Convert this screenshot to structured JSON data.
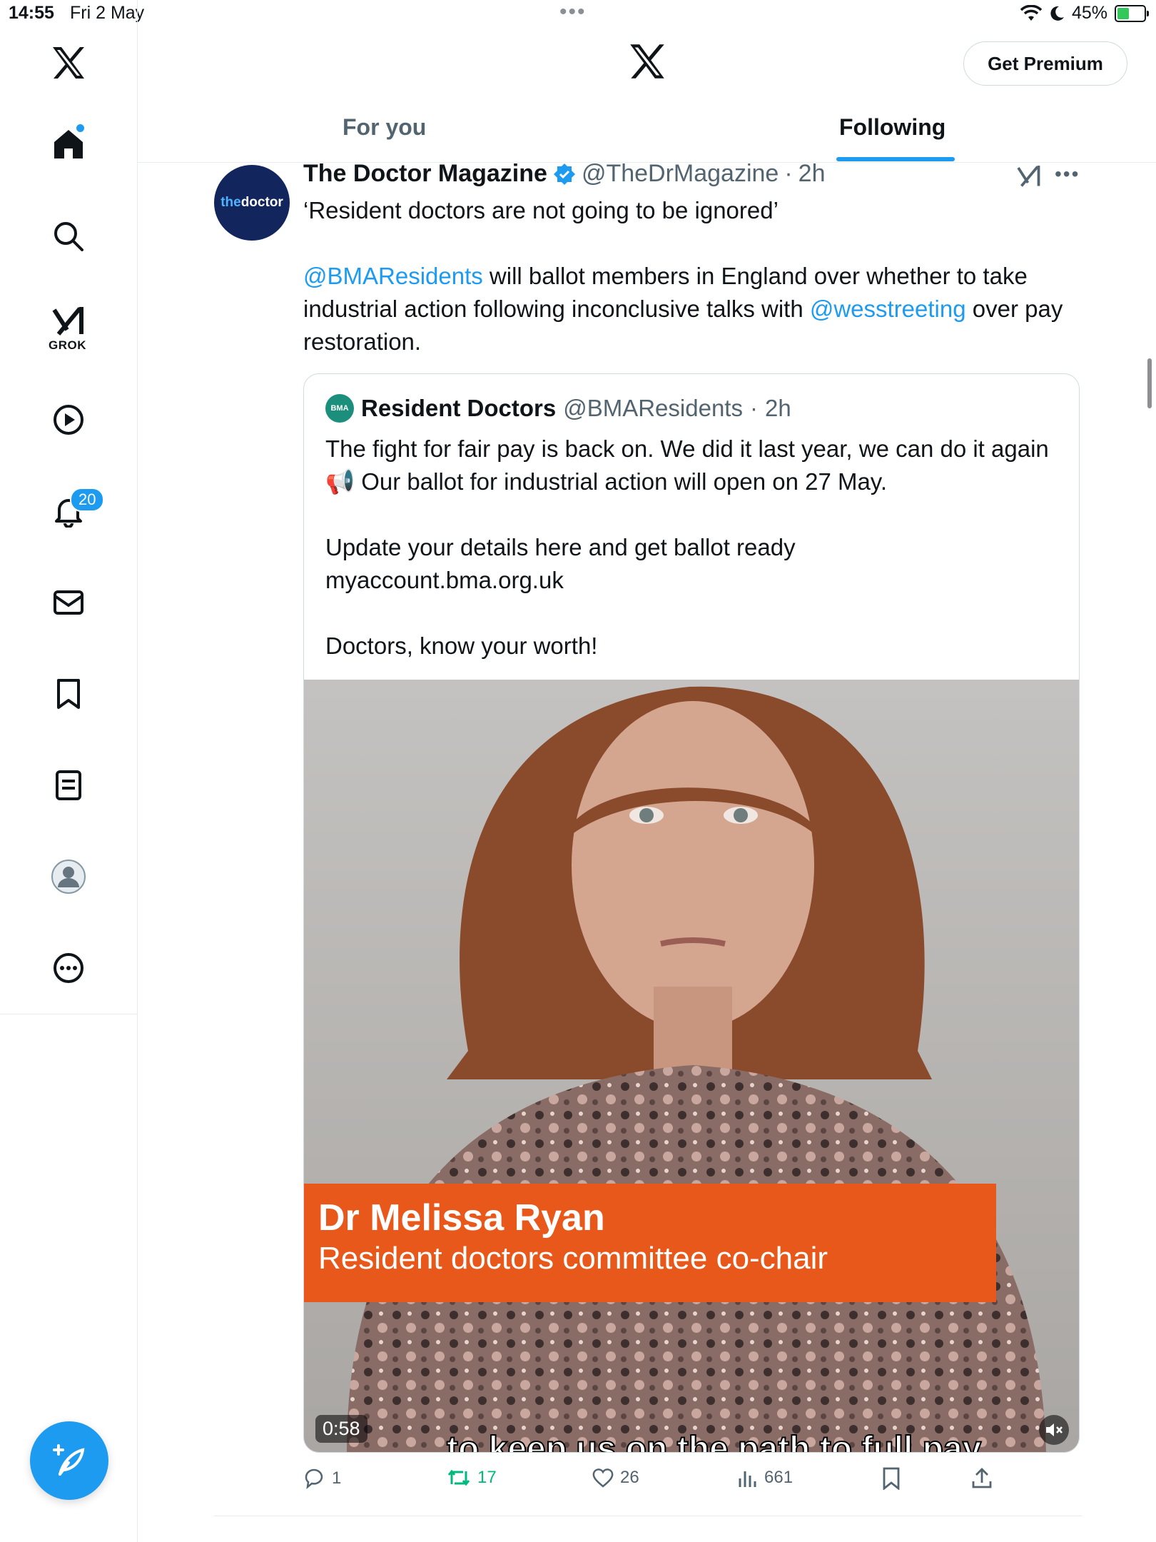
{
  "status_bar": {
    "time": "14:55",
    "date": "Fri 2 May",
    "battery": "45%",
    "battery_level": 0.45,
    "dots": "•••"
  },
  "sidebar": {
    "items": [
      {
        "name": "home"
      },
      {
        "name": "explore"
      },
      {
        "name": "grok",
        "label": "GROK"
      },
      {
        "name": "videos"
      },
      {
        "name": "notifications",
        "badge": "20"
      },
      {
        "name": "messages"
      },
      {
        "name": "bookmarks"
      },
      {
        "name": "lists"
      },
      {
        "name": "profile"
      },
      {
        "name": "more"
      }
    ]
  },
  "header": {
    "premium_label": "Get Premium",
    "tabs": [
      {
        "label": "For you"
      },
      {
        "label": "Following",
        "active": true
      }
    ]
  },
  "tweet": {
    "avatar_text_1": "the",
    "avatar_text_2": "doctor",
    "name": "The Doctor Magazine",
    "verified": true,
    "handle": "@TheDrMagazine",
    "sep": "·",
    "time": "2h",
    "line1": "‘Resident doctors are not going to be ignored’",
    "mention1": "@BMAResidents",
    "text_a": " will ballot members in England over whether to take industrial action following inconclusive talks with ",
    "mention2": "@wesstreeting",
    "text_b": " over pay restoration.",
    "quote": {
      "avatar_text": "BMA",
      "name": "Resident Doctors",
      "handle": "@BMAResidents",
      "sep": "·",
      "time": "2h",
      "para1": "The fight for fair pay is back on. We did it last year, we can do it again 📢 Our ballot for industrial action will open on 27 May.",
      "para2_line1": "Update your details here and get ballot ready",
      "para2_line2": "myaccount.bma.org.uk",
      "para3": "Doctors, know your worth!",
      "video": {
        "lower_third_name": "Dr Melissa Ryan",
        "lower_third_role": "Resident doctors committee co-chair",
        "subtitle": "to keep us on the path to full pay",
        "duration": "0:58"
      }
    },
    "actions": {
      "replies": "1",
      "retweets": "17",
      "likes": "26",
      "views": "661"
    }
  },
  "colors": {
    "accent": "#1d9bf0",
    "lower_third": "#e8581a",
    "retweet": "#00ba7c"
  }
}
